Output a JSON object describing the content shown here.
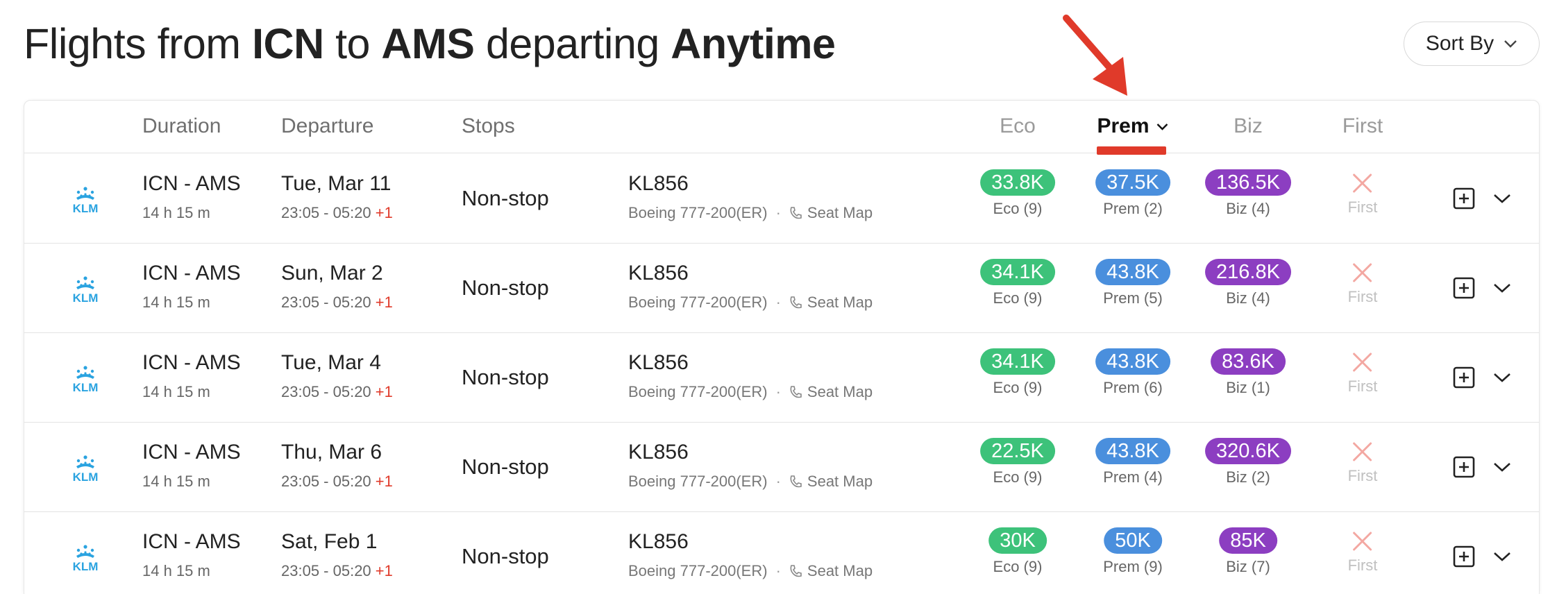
{
  "header": {
    "title_prefix": "Flights from",
    "origin": "ICN",
    "to_word": "to",
    "destination": "AMS",
    "departing_word": "departing",
    "when": "Anytime",
    "sort_label": "Sort By"
  },
  "columns": {
    "duration": "Duration",
    "departure": "Departure",
    "stops": "Stops",
    "eco": "Eco",
    "prem": "Prem",
    "biz": "Biz",
    "first": "First"
  },
  "colors": {
    "eco": "#3dc27a",
    "prem": "#4a8fdd",
    "biz": "#8c3ec1",
    "annotation": "#e03a2a",
    "klm": "#2aa3e0"
  },
  "icons": {
    "airline_logo": "klm-logo",
    "sort_chevron": "chevron-down-icon",
    "seat_map": "phone-icon",
    "unavailable": "x-icon",
    "add": "plus-square-icon",
    "expand": "chevron-down-icon",
    "annotation": "red-arrow"
  },
  "rows": [
    {
      "route": "ICN - AMS",
      "duration": "14 h 15 m",
      "date": "Tue, Mar 11",
      "time": "23:05 - 05:20",
      "day_offset": "+1",
      "stops": "Non-stop",
      "flight": "KL856",
      "aircraft": "Boeing 777-200(ER)",
      "sep": "·",
      "seat_map": "Seat Map",
      "eco": "33.8K",
      "eco_sub": "Eco (9)",
      "prem": "37.5K",
      "prem_sub": "Prem (2)",
      "biz": "136.5K",
      "biz_sub": "Biz (4)",
      "first_sub": "First"
    },
    {
      "route": "ICN - AMS",
      "duration": "14 h 15 m",
      "date": "Sun, Mar 2",
      "time": "23:05 - 05:20",
      "day_offset": "+1",
      "stops": "Non-stop",
      "flight": "KL856",
      "aircraft": "Boeing 777-200(ER)",
      "sep": "·",
      "seat_map": "Seat Map",
      "eco": "34.1K",
      "eco_sub": "Eco (9)",
      "prem": "43.8K",
      "prem_sub": "Prem (5)",
      "biz": "216.8K",
      "biz_sub": "Biz (4)",
      "first_sub": "First"
    },
    {
      "route": "ICN - AMS",
      "duration": "14 h 15 m",
      "date": "Tue, Mar 4",
      "time": "23:05 - 05:20",
      "day_offset": "+1",
      "stops": "Non-stop",
      "flight": "KL856",
      "aircraft": "Boeing 777-200(ER)",
      "sep": "·",
      "seat_map": "Seat Map",
      "eco": "34.1K",
      "eco_sub": "Eco (9)",
      "prem": "43.8K",
      "prem_sub": "Prem (6)",
      "biz": "83.6K",
      "biz_sub": "Biz (1)",
      "first_sub": "First"
    },
    {
      "route": "ICN - AMS",
      "duration": "14 h 15 m",
      "date": "Thu, Mar 6",
      "time": "23:05 - 05:20",
      "day_offset": "+1",
      "stops": "Non-stop",
      "flight": "KL856",
      "aircraft": "Boeing 777-200(ER)",
      "sep": "·",
      "seat_map": "Seat Map",
      "eco": "22.5K",
      "eco_sub": "Eco (9)",
      "prem": "43.8K",
      "prem_sub": "Prem (4)",
      "biz": "320.6K",
      "biz_sub": "Biz (2)",
      "first_sub": "First"
    },
    {
      "route": "ICN - AMS",
      "duration": "14 h 15 m",
      "date": "Sat, Feb 1",
      "time": "23:05 - 05:20",
      "day_offset": "+1",
      "stops": "Non-stop",
      "flight": "KL856",
      "aircraft": "Boeing 777-200(ER)",
      "sep": "·",
      "seat_map": "Seat Map",
      "eco": "30K",
      "eco_sub": "Eco (9)",
      "prem": "50K",
      "prem_sub": "Prem (9)",
      "biz": "85K",
      "biz_sub": "Biz (7)",
      "first_sub": "First"
    }
  ]
}
